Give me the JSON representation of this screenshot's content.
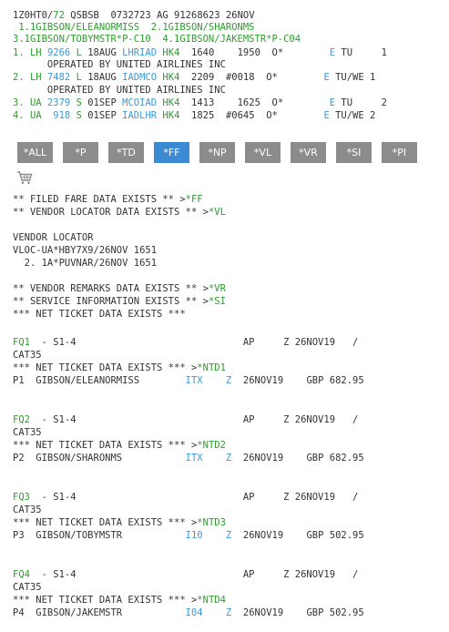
{
  "header": {
    "rec": "1Z0HT0/",
    "count": "72",
    "agency": " QSBSB  0732723 AG 91268623 26NOV"
  },
  "names": [
    " 1.1GIBSON/ELEANORMISS  2.1GIBSON/SHARONMS",
    "3.1GIBSON/TOBYMSTR*P-C10  4.1GIBSON/JAKEMSTR*P-C04"
  ],
  "segments": [
    {
      "a": "1. LH ",
      "flt": "9266",
      "b": " ",
      "cls": "L",
      "c": " 18AUG ",
      "route": "LHRIAD",
      "d": " ",
      "st": "HK4",
      "e": "  1640    1950  O*        ",
      "eq": "E",
      "f": " TU     1"
    },
    {
      "a": "2. LH ",
      "flt": "7482",
      "b": " ",
      "cls": "L",
      "c": " 18AUG ",
      "route": "IADMCO",
      "d": " ",
      "st": "HK4",
      "e": "  2209  #0018  O*        ",
      "eq": "E",
      "f": " TU/WE 1"
    },
    {
      "a": "3. UA ",
      "flt": "2379",
      "b": " ",
      "cls": "S",
      "c": " 01SEP ",
      "route": "MCOIAD",
      "d": " ",
      "st": "HK4",
      "e": "  1413    1625  O*        ",
      "eq": "E",
      "f": " TU     2"
    },
    {
      "a": "4. UA  ",
      "flt": "918",
      "b": " ",
      "cls": "S",
      "c": " 01SEP ",
      "route": "IADLHR",
      "d": " ",
      "st": "HK4",
      "e": "  1825  #0645  O*        ",
      "eq": "E",
      "f": " TU/WE 2"
    }
  ],
  "operated": "      OPERATED BY UNITED AIRLINES INC",
  "toolbar": [
    "*ALL",
    "*P",
    "*TD",
    "*FF",
    "*NP",
    "*VL",
    "*VR",
    "*SI",
    "*PI"
  ],
  "lines": {
    "ff": "** FILED FARE DATA EXISTS ** >",
    "ff_link": "*FF",
    "vl": "** VENDOR LOCATOR DATA EXISTS ** >",
    "vl_link": "*VL",
    "vloc_title": "VENDOR LOCATOR",
    "vloc1": "VLOC-UA*HBY7X9/26NOV 1651",
    "vloc2": "  2. 1A*PUVNAR/26NOV 1651",
    "vr": "** VENDOR REMARKS DATA EXISTS ** >",
    "vr_link": "*VR",
    "si": "** SERVICE INFORMATION EXISTS ** >",
    "si_link": "*SI",
    "net": "*** NET TICKET DATA EXISTS ***"
  },
  "fares": [
    {
      "fq": "FQ1",
      "fq_rest": "  - S1-4                             AP     Z 26NOV19   /",
      "cat": "CAT35",
      "net": "*** NET TICKET DATA EXISTS *** >",
      "ntd": "*NTD1",
      "p": "P1  GIBSON/ELEANORMISS        ",
      "code": "ITX",
      "z": "Z",
      "date": "26NOV19",
      "gbp": "GBP 682.95"
    },
    {
      "fq": "FQ2",
      "fq_rest": "  - S1-4                             AP     Z 26NOV19   /",
      "cat": "CAT35",
      "net": "*** NET TICKET DATA EXISTS *** >",
      "ntd": "*NTD2",
      "p": "P2  GIBSON/SHARONMS           ",
      "code": "ITX",
      "z": "Z",
      "date": "26NOV19",
      "gbp": "GBP 682.95"
    },
    {
      "fq": "FQ3",
      "fq_rest": "  - S1-4                             AP     Z 26NOV19   /",
      "cat": "CAT35",
      "net": "*** NET TICKET DATA EXISTS *** >",
      "ntd": "*NTD3",
      "p": "P3  GIBSON/TOBYMSTR           ",
      "code": "I10",
      "z": "Z",
      "date": "26NOV19",
      "gbp": "GBP 502.95"
    },
    {
      "fq": "FQ4",
      "fq_rest": "  - S1-4                             AP     Z 26NOV19   /",
      "cat": "CAT35",
      "net": "*** NET TICKET DATA EXISTS *** >",
      "ntd": "*NTD4",
      "p": "P4  GIBSON/JAKEMSTR           ",
      "code": "I04",
      "z": "Z",
      "date": "26NOV19",
      "gbp": "GBP 502.95"
    }
  ]
}
